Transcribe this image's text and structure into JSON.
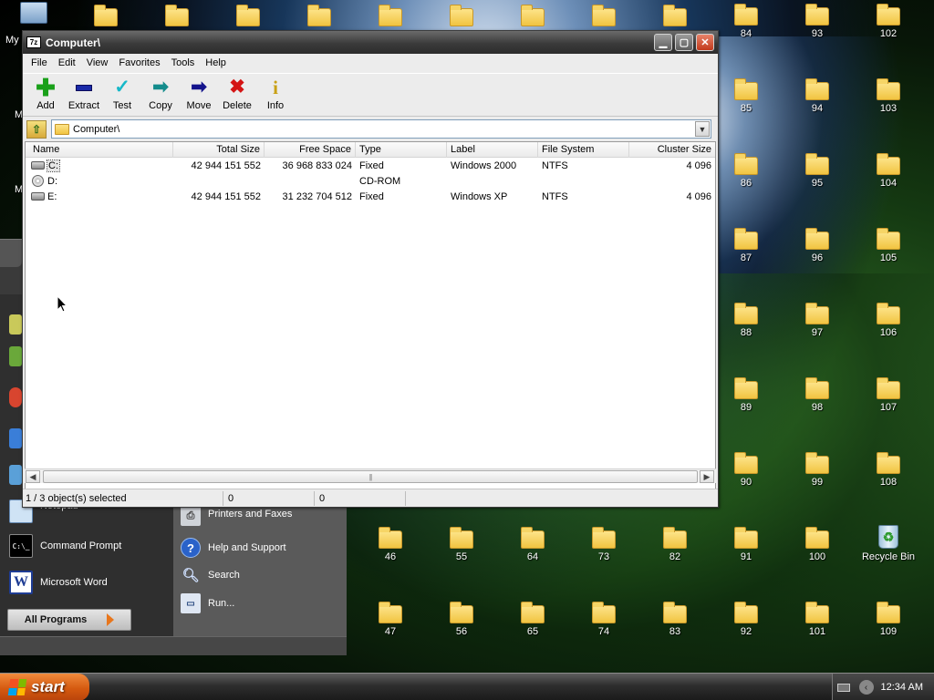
{
  "desktop": {
    "top_folders": [
      "84",
      "93",
      "102"
    ],
    "grid_col1": [
      "85",
      "86",
      "87",
      "88",
      "89",
      "90"
    ],
    "grid_col2": [
      "94",
      "95",
      "96",
      "97",
      "98",
      "99"
    ],
    "grid_col3": [
      "103",
      "104",
      "105",
      "106",
      "107",
      "108"
    ],
    "row_a": [
      "46",
      "55",
      "64",
      "73",
      "82",
      "91",
      "100"
    ],
    "row_b": [
      "47",
      "56",
      "65",
      "74",
      "83",
      "92",
      "101",
      "109"
    ],
    "recycle_bin": "Recycle Bin",
    "my_computer_label": "My"
  },
  "start_menu": {
    "notepad": "Notepad",
    "command_prompt": "Command Prompt",
    "microsoft_word": "Microsoft Word",
    "all_programs": "All Programs",
    "printers_faxes": "Printers and Faxes",
    "help_support": "Help and Support",
    "search": "Search",
    "run": "Run..."
  },
  "window": {
    "title": "Computer\\",
    "app_icon": "7z",
    "menu": [
      "File",
      "Edit",
      "View",
      "Favorites",
      "Tools",
      "Help"
    ],
    "toolbar": [
      {
        "label": "Add",
        "icon": "plus-icon",
        "color": "#1aa01a"
      },
      {
        "label": "Extract",
        "icon": "minus-icon",
        "color": "#1a2aa8"
      },
      {
        "label": "Test",
        "icon": "checkmark-icon",
        "color": "#16b8c8"
      },
      {
        "label": "Copy",
        "icon": "copy-arrow-icon",
        "color": "#148c8c"
      },
      {
        "label": "Move",
        "icon": "move-arrow-icon",
        "color": "#14148c"
      },
      {
        "label": "Delete",
        "icon": "delete-x-icon",
        "color": "#d41414"
      },
      {
        "label": "Info",
        "icon": "info-icon",
        "color": "#c8a014"
      }
    ],
    "address": "Computer\\",
    "columns": [
      "Name",
      "Total Size",
      "Free Space",
      "Type",
      "Label",
      "File System",
      "Cluster Size"
    ],
    "rows": [
      {
        "name": "C:",
        "total": "42 944 151 552",
        "free": "36 968 833 024",
        "type": "Fixed",
        "label": "Windows 2000",
        "fs": "NTFS",
        "cluster": "4 096",
        "icon": "hard-drive-icon"
      },
      {
        "name": "D:",
        "total": "",
        "free": "",
        "type": "CD-ROM",
        "label": "",
        "fs": "",
        "cluster": "",
        "icon": "cd-rom-icon"
      },
      {
        "name": "E:",
        "total": "42 944 151 552",
        "free": "31 232 704 512",
        "type": "Fixed",
        "label": "Windows XP",
        "fs": "NTFS",
        "cluster": "4 096",
        "icon": "hard-drive-icon"
      }
    ],
    "status": [
      "1 / 3 object(s) selected",
      "0",
      "0"
    ]
  },
  "taskbar": {
    "start": "start",
    "clock": "12:34 AM"
  }
}
